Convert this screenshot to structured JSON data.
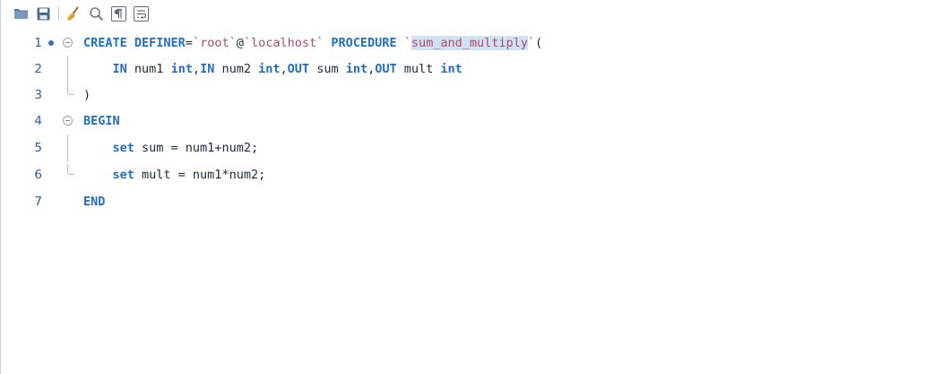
{
  "toolbar": {
    "buttons": [
      {
        "name": "open-folder-icon"
      },
      {
        "name": "save-icon"
      },
      {
        "name": "beautify-icon"
      },
      {
        "name": "find-icon"
      },
      {
        "name": "invisible-chars-icon"
      },
      {
        "name": "word-wrap-icon"
      }
    ]
  },
  "editor": {
    "line_numbers": [
      "1",
      "2",
      "3",
      "4",
      "5",
      "6",
      "7"
    ],
    "lines": [
      {
        "tokens": [
          {
            "t": "CREATE DEFINER",
            "c": "kw"
          },
          {
            "t": "=",
            "c": ""
          },
          {
            "t": "`root`",
            "c": "str"
          },
          {
            "t": "@",
            "c": ""
          },
          {
            "t": "`localhost`",
            "c": "str"
          },
          {
            "t": " ",
            "c": ""
          },
          {
            "t": "PROCEDURE",
            "c": "kw"
          },
          {
            "t": " ",
            "c": ""
          },
          {
            "t": "`",
            "c": "str"
          },
          {
            "t": "sum_and_multiply",
            "c": "str hl"
          },
          {
            "t": "`",
            "c": "str"
          },
          {
            "t": "(",
            "c": ""
          }
        ]
      },
      {
        "tokens": [
          {
            "t": "    ",
            "c": ""
          },
          {
            "t": "IN",
            "c": "kw"
          },
          {
            "t": " num1 ",
            "c": ""
          },
          {
            "t": "int",
            "c": "kw"
          },
          {
            "t": ",",
            "c": ""
          },
          {
            "t": "IN",
            "c": "kw"
          },
          {
            "t": " num2 ",
            "c": ""
          },
          {
            "t": "int",
            "c": "kw"
          },
          {
            "t": ",",
            "c": ""
          },
          {
            "t": "OUT",
            "c": "kw"
          },
          {
            "t": " sum ",
            "c": ""
          },
          {
            "t": "int",
            "c": "kw"
          },
          {
            "t": ",",
            "c": ""
          },
          {
            "t": "OUT",
            "c": "kw"
          },
          {
            "t": " mult ",
            "c": ""
          },
          {
            "t": "int",
            "c": "kw"
          }
        ]
      },
      {
        "tokens": [
          {
            "t": ")",
            "c": ""
          }
        ]
      },
      {
        "tokens": [
          {
            "t": "BEGIN",
            "c": "kw"
          }
        ]
      },
      {
        "tokens": [
          {
            "t": "    ",
            "c": ""
          },
          {
            "t": "set",
            "c": "kw"
          },
          {
            "t": " sum = num1+num2;",
            "c": ""
          }
        ]
      },
      {
        "tokens": [
          {
            "t": "    ",
            "c": ""
          },
          {
            "t": "set",
            "c": "kw"
          },
          {
            "t": " mult = num1*num2;",
            "c": ""
          }
        ]
      },
      {
        "tokens": [
          {
            "t": "END",
            "c": "kw"
          }
        ]
      }
    ]
  }
}
